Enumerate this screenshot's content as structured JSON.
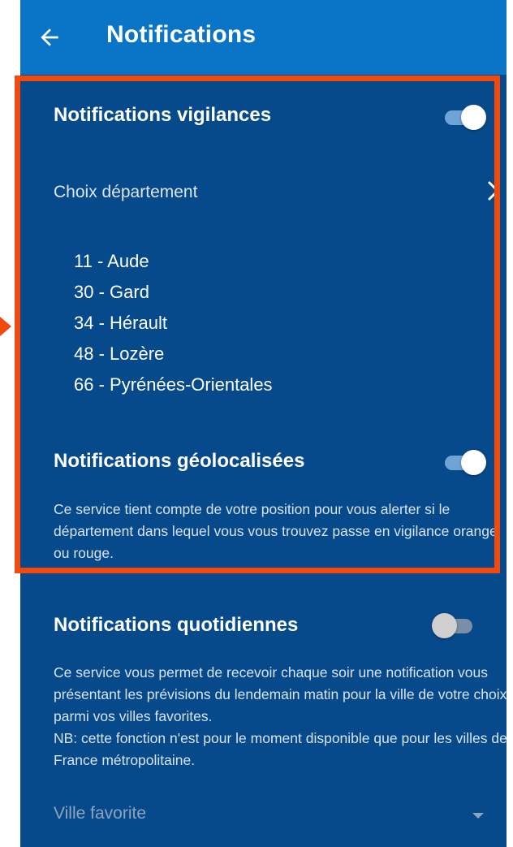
{
  "app_bar": {
    "title": "Notifications",
    "back_icon": "arrow-left-icon"
  },
  "vigilance": {
    "title": "Notifications vigilances",
    "enabled": true,
    "department_choice_label": "Choix département",
    "departments": [
      "11 - Aude",
      "30 - Gard",
      "34 - Hérault",
      "48 - Lozère",
      "66 - Pyrénées-Orientales"
    ]
  },
  "geoloc": {
    "title": "Notifications géolocalisées",
    "enabled": true,
    "description": "Ce service tient compte de votre position pour vous alerter si le département dans lequel vous vous trouvez passe en vigilance orange ou rouge."
  },
  "daily": {
    "title": "Notifications quotidiennes",
    "enabled": false,
    "description": "Ce service vous permet de recevoir chaque soir une notification vous présentant les prévisions du lendemain matin pour la ville de votre choix parmi vos villes favorites.",
    "note": "NB: cette fonction n'est pour le moment disponible que pour les villes de France métropolitaine.",
    "favorite_city_placeholder": "Ville favorite"
  },
  "colors": {
    "app_bar": "#0a74c6",
    "background": "#064a8c",
    "highlight_border": "#f24a0c",
    "toggle_on_track": "#6ea5d6"
  }
}
